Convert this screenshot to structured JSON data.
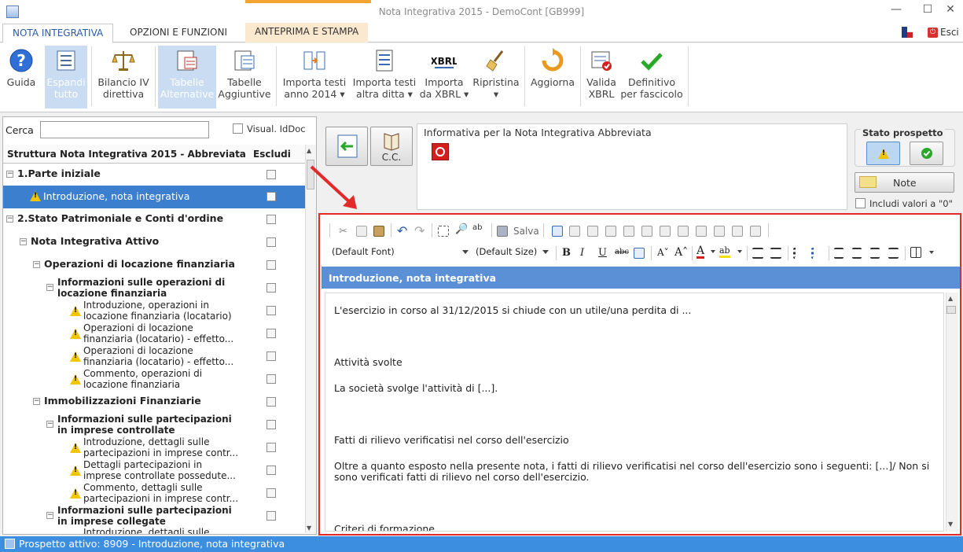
{
  "window": {
    "title": "Nota Integrativa 2015 - DemoCont [GB999]",
    "min": "—",
    "max": "☐",
    "close": "✕"
  },
  "tabs": [
    {
      "label": "NOTA INTEGRATIVA",
      "active": true
    },
    {
      "label": "OPZIONI E FUNZIONI",
      "active": false
    },
    {
      "label": "ANTEPRIMA E STAMPA",
      "active": false
    }
  ],
  "top_right": {
    "exit_label": "Esci"
  },
  "ribbon": [
    {
      "line1": "Guida",
      "line2": "",
      "icon": "help-icon"
    },
    {
      "line1": "Espandi",
      "line2": "tutto",
      "icon": "expand-icon",
      "selected": true
    },
    {
      "line1": "Bilancio IV",
      "line2": "direttiva",
      "icon": "balance-icon"
    },
    {
      "line1": "Tabelle",
      "line2": "Alternative",
      "icon": "table-alt-icon",
      "selected": true
    },
    {
      "line1": "Tabelle",
      "line2": "Aggiuntive",
      "icon": "table-add-icon"
    },
    {
      "line1": "Importa testi",
      "line2": "anno 2014 ▾",
      "icon": "import-icon"
    },
    {
      "line1": "Importa testi",
      "line2": "altra ditta ▾",
      "icon": "import-other-icon"
    },
    {
      "line1": "Importa",
      "line2": "da XBRL ▾",
      "icon": "xbrl-icon"
    },
    {
      "line1": "Ripristina",
      "line2": "▾",
      "icon": "broom-icon"
    },
    {
      "line1": "Aggiorna",
      "line2": "",
      "icon": "refresh-icon"
    },
    {
      "line1": "Valida",
      "line2": "XBRL",
      "icon": "validate-icon"
    },
    {
      "line1": "Definitivo",
      "line2": "per fascicolo",
      "icon": "check-icon"
    }
  ],
  "search": {
    "label": "Cerca",
    "value": "",
    "idoc_label": "Visual. IdDoc"
  },
  "tree": {
    "header_title": "Struttura Nota Integrativa 2015 - Abbreviata",
    "header_exclude": "Escludi",
    "rows": [
      {
        "l1": "1.Parte iniziale",
        "l2": ""
      },
      {
        "l1": "Introduzione, nota integrativa",
        "l2": ""
      },
      {
        "l1": "2.Stato Patrimoniale e Conti d'ordine",
        "l2": ""
      },
      {
        "l1": "Nota Integrativa Attivo",
        "l2": ""
      },
      {
        "l1": "Operazioni di locazione finanziaria",
        "l2": ""
      },
      {
        "l1": "Informazioni sulle operazioni di",
        "l2": "locazione finanziaria"
      },
      {
        "l1": "Introduzione, operazioni in",
        "l2": "locazione finanziaria (locatario)"
      },
      {
        "l1": "Operazioni di locazione",
        "l2": "finanziaria (locatario) - effetto..."
      },
      {
        "l1": "Operazioni di locazione",
        "l2": "finanziaria (locatario) - effetto..."
      },
      {
        "l1": "Commento, operazioni di",
        "l2": "locazione finanziaria"
      },
      {
        "l1": "Immobilizzazioni Finanziarie",
        "l2": ""
      },
      {
        "l1": "Informazioni sulle partecipazioni",
        "l2": "in imprese controllate"
      },
      {
        "l1": "Introduzione, dettagli sulle",
        "l2": "partecipazioni in imprese contr..."
      },
      {
        "l1": "Dettagli partecipazioni in",
        "l2": "imprese controllate possedute..."
      },
      {
        "l1": "Commento, dettagli sulle",
        "l2": "partecipazioni in imprese contr..."
      },
      {
        "l1": "Informazioni sulle partecipazioni",
        "l2": "in imprese collegate"
      },
      {
        "l1": "Introduzione, dettagli sulle",
        "l2": ""
      }
    ]
  },
  "panel": {
    "cc_label": "C.C.",
    "info_label": "Informativa per la Nota Integrativa Abbreviata",
    "stato_label": "Stato prospetto",
    "note_label": "Note",
    "includi_label": "Includi valori a \"0\""
  },
  "editor": {
    "salva_label": "Salva",
    "font": "(Default Font)",
    "size": "(Default Size)",
    "section_title": "Introduzione, nota integrativa",
    "paragraphs": [
      "L'esercizio in corso al 31/12/2015 si chiude con un utile/una perdita di ...",
      "Attività svolte",
      "La società svolge l'attività di [...].",
      "Fatti di rilievo verificatisi nel corso dell'esercizio",
      "Oltre a quanto esposto nella presente nota, i fatti di rilievo verificatisi nel corso dell'esercizio sono i seguenti: [...]/ Non si",
      "sono verificati fatti di rilievo nel corso dell'esercizio.",
      "Criteri di formazione"
    ]
  },
  "status": {
    "text": "Prospetto attivo: 8909 - Introduzione, nota integrativa"
  },
  "colors": {
    "accent": "#3d7fcf",
    "status_bar": "#3c8ee0",
    "highlight_frame": "#e12a2a",
    "section_bar": "#5b8fd6",
    "warning": "#f2c500"
  }
}
